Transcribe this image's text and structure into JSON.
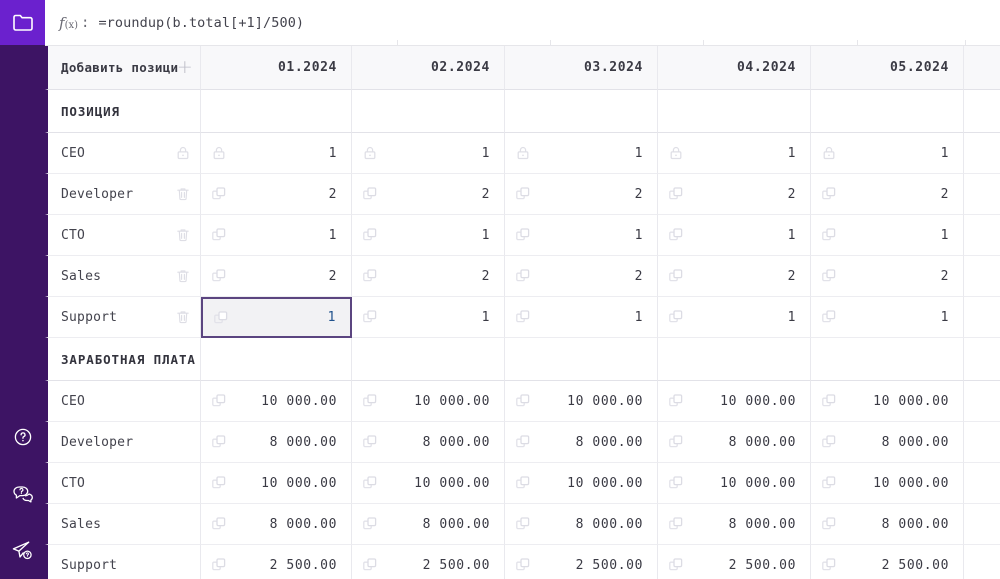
{
  "app": {
    "accent_bright": "#6b21ce",
    "accent_dark": "#3d1464",
    "selection_border": "#5b4580"
  },
  "sidebar": {
    "top_icon": "folder-icon",
    "items": [
      {
        "name": "help-icon",
        "label": "Help"
      },
      {
        "name": "chat-support-icon",
        "label": "Support chat"
      },
      {
        "name": "send-feedback-icon",
        "label": "Send"
      }
    ]
  },
  "formula_bar": {
    "prefix": "f",
    "prefix_sub": "(x)",
    "colon": ":",
    "value": "=roundup(b.total[+1]/500)"
  },
  "table": {
    "header": {
      "name_label": "Добавить позици",
      "add_icon": "+",
      "columns": [
        "01.2024",
        "02.2024",
        "03.2024",
        "04.2024",
        "05.2024",
        ""
      ]
    },
    "sections": [
      {
        "title": "ПОЗИЦИЯ",
        "rows": [
          {
            "label": "CEO",
            "row_icon": "lock-icon",
            "cell_icon": "lock-icon",
            "values": [
              "1",
              "1",
              "1",
              "1",
              "1",
              ""
            ]
          },
          {
            "label": "Developer",
            "row_icon": "trash-icon",
            "cell_icon": "copy-icon",
            "values": [
              "2",
              "2",
              "2",
              "2",
              "2",
              ""
            ]
          },
          {
            "label": "CTO",
            "row_icon": "trash-icon",
            "cell_icon": "copy-icon",
            "values": [
              "1",
              "1",
              "1",
              "1",
              "1",
              ""
            ]
          },
          {
            "label": "Sales",
            "row_icon": "trash-icon",
            "cell_icon": "copy-icon",
            "values": [
              "2",
              "2",
              "2",
              "2",
              "2",
              ""
            ]
          },
          {
            "label": "Support",
            "row_icon": "trash-icon",
            "cell_icon": "copy-icon",
            "values": [
              "1",
              "1",
              "1",
              "1",
              "1",
              ""
            ],
            "selected_col": 0
          }
        ]
      },
      {
        "title": "ЗАРАБОТНАЯ  ПЛАТА",
        "rows": [
          {
            "label": "CEO",
            "cell_icon": "copy-icon",
            "values": [
              "10 000.00",
              "10 000.00",
              "10 000.00",
              "10 000.00",
              "10 000.00",
              ""
            ]
          },
          {
            "label": "Developer",
            "cell_icon": "copy-icon",
            "values": [
              "8 000.00",
              "8 000.00",
              "8 000.00",
              "8 000.00",
              "8 000.00",
              ""
            ]
          },
          {
            "label": "CTO",
            "cell_icon": "copy-icon",
            "values": [
              "10 000.00",
              "10 000.00",
              "10 000.00",
              "10 000.00",
              "10 000.00",
              ""
            ]
          },
          {
            "label": "Sales",
            "cell_icon": "copy-icon",
            "values": [
              "8 000.00",
              "8 000.00",
              "8 000.00",
              "8 000.00",
              "8 000.00",
              ""
            ]
          },
          {
            "label": "Support",
            "cell_icon": "copy-icon",
            "values": [
              "2 500.00",
              "2 500.00",
              "2 500.00",
              "2 500.00",
              "2 500.00",
              ""
            ]
          }
        ]
      }
    ]
  }
}
